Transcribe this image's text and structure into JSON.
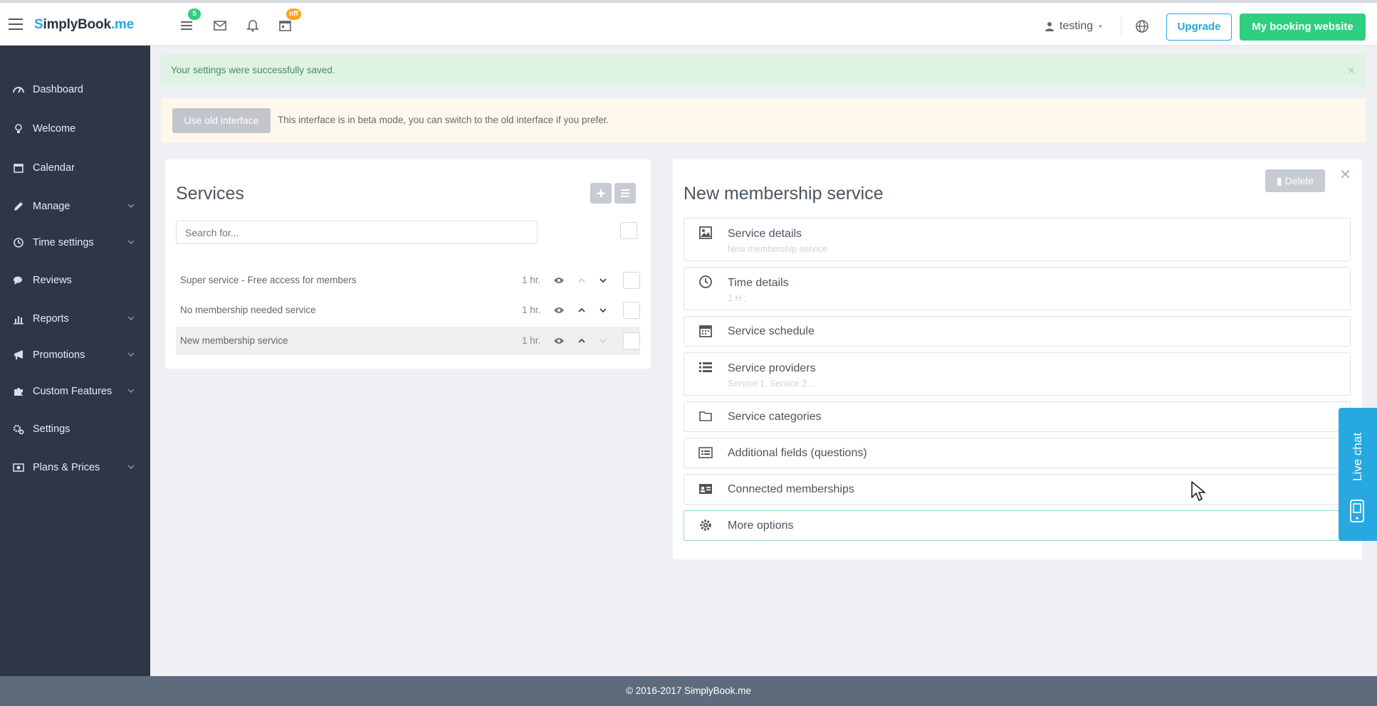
{
  "topbar": {
    "brand_first": "S",
    "brand_mid": "implyBook",
    "brand_tld": ".me",
    "badge_tasks": "5",
    "badge_offers": "off",
    "username": "testing",
    "upgrade_label": "Upgrade",
    "booking_label": "My booking website"
  },
  "sidebar": {
    "items": [
      {
        "label": "Dashboard",
        "icon": "dashboard-icon"
      },
      {
        "label": "Welcome",
        "icon": "lightbulb-icon"
      },
      {
        "label": "Calendar",
        "icon": "calendar-icon"
      },
      {
        "label": "Manage",
        "icon": "pencil-icon",
        "expandable": true
      },
      {
        "label": "Time settings",
        "icon": "clock-icon",
        "expandable": true
      },
      {
        "label": "Reviews",
        "icon": "comments-icon"
      },
      {
        "label": "Reports",
        "icon": "bar-chart-icon",
        "expandable": true
      },
      {
        "label": "Promotions",
        "icon": "bullhorn-icon",
        "expandable": true
      },
      {
        "label": "Custom Features",
        "icon": "puzzle-icon",
        "expandable": true
      },
      {
        "label": "Settings",
        "icon": "cogs-icon"
      },
      {
        "label": "Plans & Prices",
        "icon": "money-icon",
        "expandable": true
      }
    ]
  },
  "alerts": {
    "success": "Your settings were successfully saved.",
    "beta_button": "Use old interface",
    "beta_text": "This interface is in beta mode, you can switch to the old interface if you prefer."
  },
  "services": {
    "title": "Services",
    "search_placeholder": "Search for...",
    "items": [
      {
        "name": "Super service - Free access for members",
        "duration": "1 hr."
      },
      {
        "name": "No membership needed service",
        "duration": "1 hr."
      },
      {
        "name": "New membership service",
        "duration": "1 hr.",
        "selected": true
      }
    ]
  },
  "detail": {
    "title": "New membership service",
    "delete_label": "Delete",
    "close_symbol": "✕",
    "sections": [
      {
        "label": "Service details",
        "sub": "New membership service",
        "icon": "image-icon"
      },
      {
        "label": "Time details",
        "sub": "1 H :",
        "icon": "clock-icon"
      },
      {
        "label": "Service schedule",
        "sub": "",
        "icon": "calendar-icon"
      },
      {
        "label": "Service providers",
        "sub": "Service 1, Service 2...",
        "icon": "list-icon"
      },
      {
        "label": "Service categories",
        "sub": "",
        "icon": "folder-icon"
      },
      {
        "label": "Additional fields (questions)",
        "sub": "",
        "icon": "form-icon"
      },
      {
        "label": "Connected memberships",
        "sub": "",
        "icon": "id-card-icon"
      },
      {
        "label": "More options",
        "sub": "",
        "icon": "gear-icon"
      }
    ]
  },
  "livechat": {
    "label": "Live chat"
  },
  "footer": {
    "copyright": "© 2016-2017 SimplyBook.me"
  },
  "colors": {
    "sidebar": "#2d3748",
    "accent_blue": "#27a8e0",
    "accent_green": "#2ecf7e",
    "footer": "#5e6b7d"
  }
}
